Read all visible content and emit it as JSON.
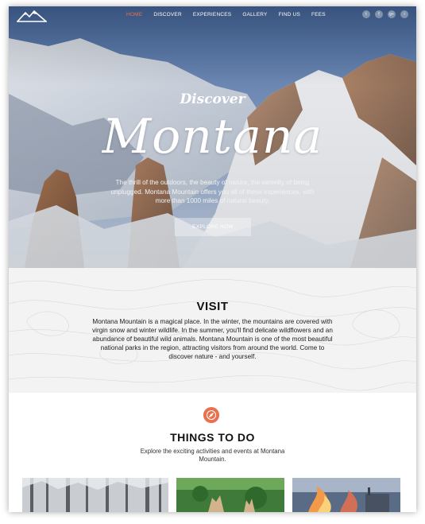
{
  "nav": {
    "items": [
      "HOME",
      "DISCOVER",
      "EXPERIENCES",
      "GALLERY",
      "FIND US",
      "FEES"
    ],
    "active_index": 0,
    "socials": [
      "twitter-icon",
      "facebook-icon",
      "google-plus-icon",
      "instagram-icon"
    ],
    "social_glyphs": [
      "t",
      "f",
      "g+",
      "i"
    ]
  },
  "hero": {
    "kicker": "Discover",
    "title": "Montana",
    "text": "The thrill of the outdoors, the beauty of nature, the serenity of being unplugged. Montana Mountain offers you all of these experiences, with more than 1000 miles of natural beauty.",
    "button_label": "EXPLORE NOW"
  },
  "visit": {
    "title": "VISIT",
    "text": "Montana Mountain is a magical place. In the winter, the mountains are covered with virgin snow and winter wildlife. In the summer, you'll find delicate wildflowers and an abundance of beautiful wild animals. Montana Mountain is one of the most beautiful national parks in the region, attracting visitors from around the world. Come to discover nature - and yourself."
  },
  "things": {
    "title": "THINGS TO DO",
    "text": "Explore the exciting activities and events at Montana Mountain."
  },
  "colors": {
    "accent": "#e8714f",
    "text_dark": "#111111"
  }
}
